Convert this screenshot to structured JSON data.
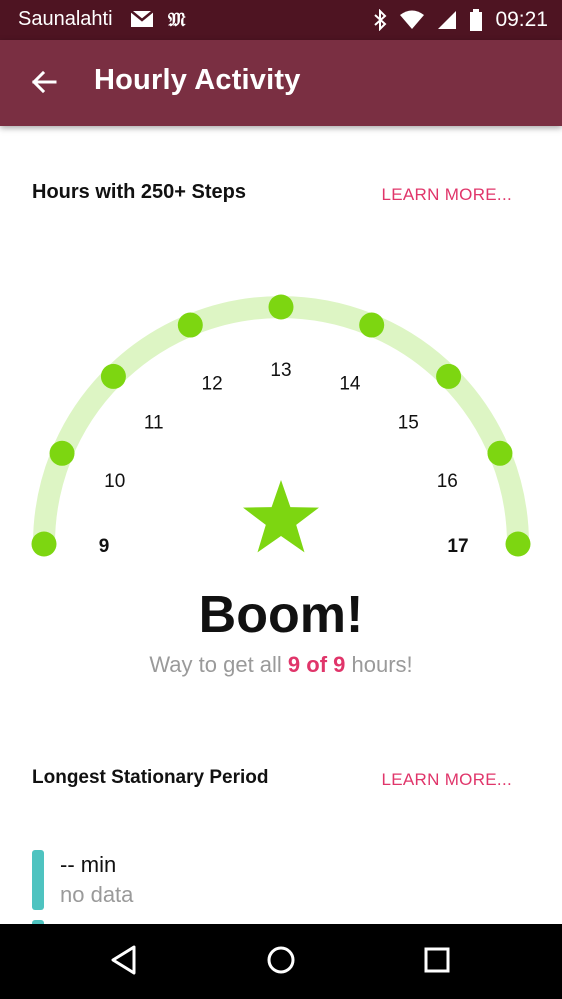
{
  "status_bar": {
    "carrier": "Saunalahti",
    "time": "09:21",
    "icons": [
      "gmail-icon",
      "news-icon",
      "bluetooth-icon",
      "wifi-icon",
      "signal-icon",
      "battery-icon"
    ]
  },
  "app_bar": {
    "title": "Hourly Activity",
    "back_icon": "arrow-left-icon"
  },
  "hours_section": {
    "title": "Hours with 250+ Steps",
    "learn_more": "LEARN MORE..."
  },
  "gauge": {
    "hours": [
      "9",
      "10",
      "11",
      "12",
      "13",
      "14",
      "15",
      "16",
      "17"
    ],
    "hours_met": [
      true,
      true,
      true,
      true,
      true,
      true,
      true,
      true,
      true
    ],
    "track_color": "#ddf5c4",
    "dot_color": "#7dd611",
    "star_color": "#7dd611"
  },
  "result": {
    "title": "Boom!",
    "prefix": "Way to get all ",
    "highlight": "9 of 9",
    "suffix": " hours!"
  },
  "stationary_section": {
    "title": "Longest Stationary Period",
    "learn_more": "LEARN MORE...",
    "value": "-- min",
    "note": "no data",
    "bar_color": "#4ec3c0"
  },
  "nav_bar": {
    "back": "nav-back-icon",
    "home": "nav-home-icon",
    "recents": "nav-recents-icon"
  },
  "colors": {
    "status_bar": "#4e1422",
    "app_bar": "#7a2f42",
    "accent": "#e0356a"
  }
}
